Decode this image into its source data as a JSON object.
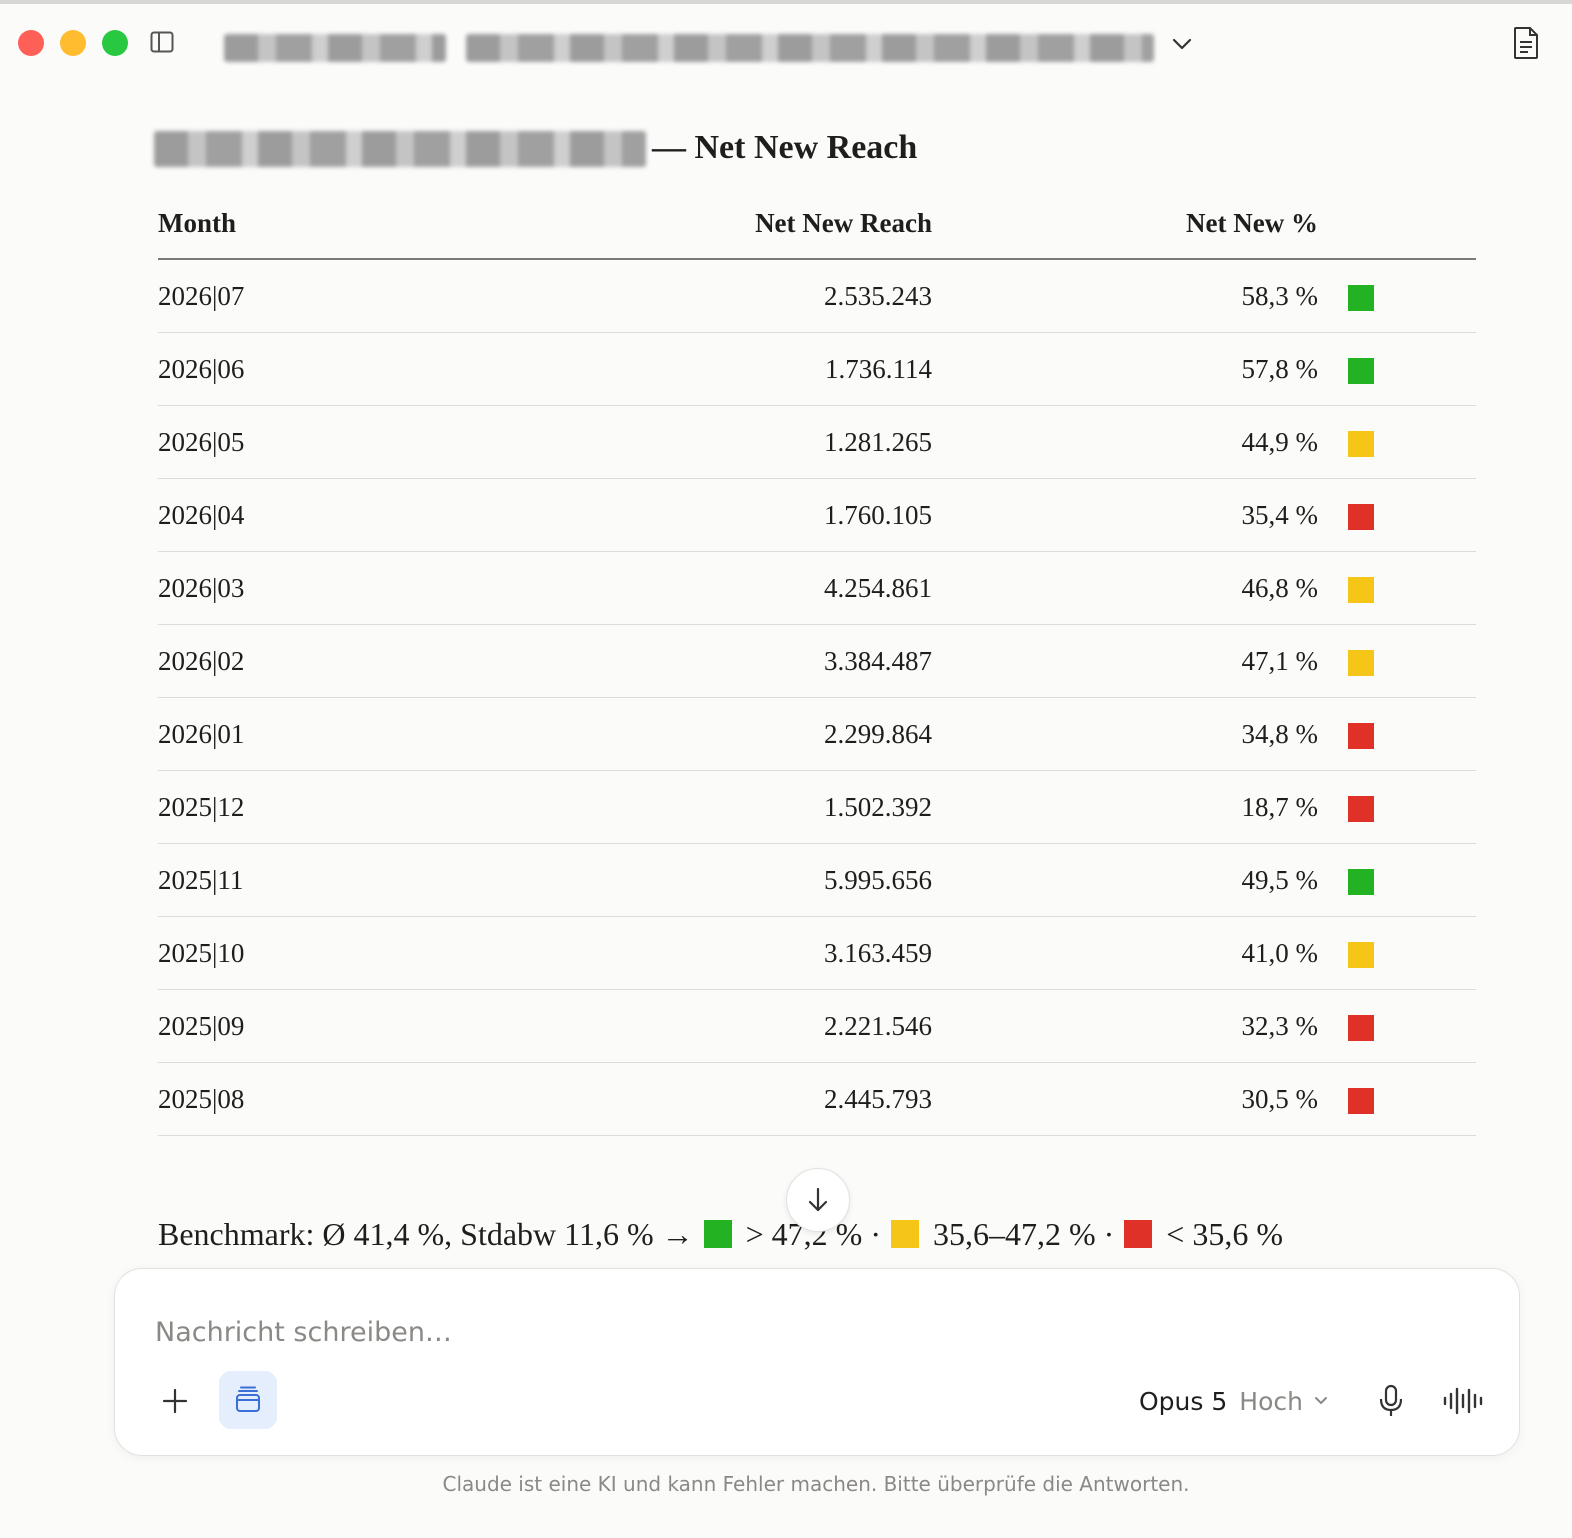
{
  "window": {
    "heading_suffix": "— Net New Reach"
  },
  "table": {
    "headers": {
      "month": "Month",
      "reach": "Net New Reach",
      "pct": "Net New %"
    },
    "rows": [
      {
        "month": "2026|07",
        "reach": "2.535.243",
        "pct": "58,3 %",
        "status": "green"
      },
      {
        "month": "2026|06",
        "reach": "1.736.114",
        "pct": "57,8 %",
        "status": "green"
      },
      {
        "month": "2026|05",
        "reach": "1.281.265",
        "pct": "44,9 %",
        "status": "yellow"
      },
      {
        "month": "2026|04",
        "reach": "1.760.105",
        "pct": "35,4 %",
        "status": "red"
      },
      {
        "month": "2026|03",
        "reach": "4.254.861",
        "pct": "46,8 %",
        "status": "yellow"
      },
      {
        "month": "2026|02",
        "reach": "3.384.487",
        "pct": "47,1 %",
        "status": "yellow"
      },
      {
        "month": "2026|01",
        "reach": "2.299.864",
        "pct": "34,8 %",
        "status": "red"
      },
      {
        "month": "2025|12",
        "reach": "1.502.392",
        "pct": "18,7 %",
        "status": "red"
      },
      {
        "month": "2025|11",
        "reach": "5.995.656",
        "pct": "49,5 %",
        "status": "green"
      },
      {
        "month": "2025|10",
        "reach": "3.163.459",
        "pct": "41,0 %",
        "status": "yellow"
      },
      {
        "month": "2025|09",
        "reach": "2.221.546",
        "pct": "32,3 %",
        "status": "red"
      },
      {
        "month": "2025|08",
        "reach": "2.445.793",
        "pct": "30,5 %",
        "status": "red"
      }
    ]
  },
  "benchmark": {
    "prefix": "Benchmark: Ø 41,4 %, Stdabw 11,6 % → ",
    "green_text": " > 47,2 % · ",
    "yellow_text": " 35,6–47,2 % · ",
    "red_text": " < 35,6 %"
  },
  "composer": {
    "placeholder": "Nachricht schreiben…",
    "model": "Opus 5",
    "effort": "Hoch"
  },
  "disclaimer": "Claude ist eine KI und kann Fehler machen. Bitte überprüfe die Antworten.",
  "colors": {
    "green": "#22b222",
    "yellow": "#f5c518",
    "red": "#e03128",
    "traffic_red": "#fe5f57",
    "traffic_yellow": "#febc2e",
    "traffic_green": "#28c840",
    "project_button_bg": "#e5eefc"
  },
  "icons": {
    "sidebar_toggle": "sidebar-toggle-icon",
    "title_menu": "chevron-down-icon",
    "artifact": "document-icon",
    "scroll": "arrow-down-icon",
    "add": "plus-icon",
    "project": "project-box-icon",
    "mic": "microphone-icon",
    "voice": "voice-waveform-icon"
  }
}
